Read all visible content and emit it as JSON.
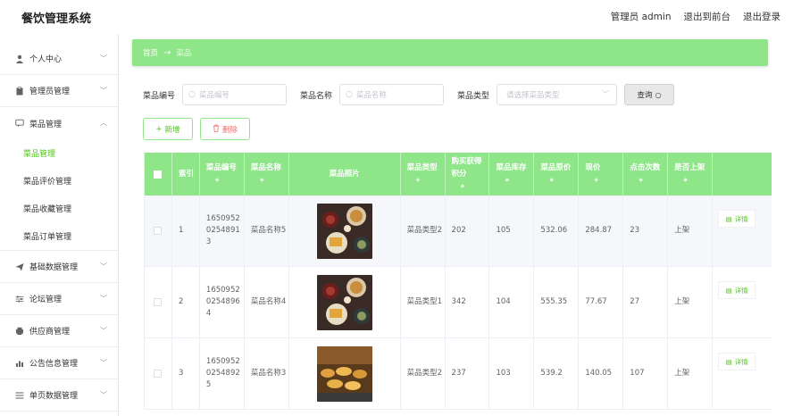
{
  "header": {
    "app_title": "餐饮管理系统",
    "admin_label": "管理员 admin",
    "back_frontend": "退出到前台",
    "logout": "退出登录"
  },
  "sidebar": {
    "groups": [
      {
        "label": "个人中心",
        "icon": "user-icon"
      },
      {
        "label": "管理员管理",
        "icon": "clipboard-icon"
      },
      {
        "label": "菜品管理",
        "icon": "chat-icon",
        "expanded": true,
        "children": [
          "菜品管理",
          "菜品评价管理",
          "菜品收藏管理",
          "菜品订单管理"
        ]
      },
      {
        "label": "基础数据管理",
        "icon": "send-icon"
      },
      {
        "label": "论坛管理",
        "icon": "sliders-icon"
      },
      {
        "label": "供应商管理",
        "icon": "printer-icon"
      },
      {
        "label": "公告信息管理",
        "icon": "chart-icon"
      },
      {
        "label": "单页数据管理",
        "icon": "menu-icon"
      }
    ],
    "active_child": "菜品管理"
  },
  "breadcrumb": {
    "home": "首页",
    "current": "菜品"
  },
  "filters": {
    "code_label": "菜品编号",
    "code_placeholder": "菜品编号",
    "name_label": "菜品名称",
    "name_placeholder": "菜品名称",
    "type_label": "菜品类型",
    "type_placeholder": "请选择菜品类型",
    "query_button": "查询"
  },
  "actions": {
    "add": "新增",
    "delete": "删除"
  },
  "table": {
    "headers": [
      "索引",
      "菜品编号",
      "菜品名称",
      "菜品照片",
      "菜品类型",
      "购买获得积分",
      "菜品库存",
      "菜品原价",
      "现价",
      "点击次数",
      "是否上架"
    ],
    "detail_label": "详情",
    "rows": [
      {
        "index": "1",
        "code": "16509520254891 3",
        "name": "菜品名称5",
        "type": "菜品类型2",
        "points": "202",
        "stock": "105",
        "orig_price": "532.06",
        "price": "284.87",
        "clicks": "23",
        "onsale": "上架"
      },
      {
        "index": "2",
        "code": "16509520254896 4",
        "name": "菜品名称4",
        "type": "菜品类型1",
        "points": "342",
        "stock": "104",
        "orig_price": "555.35",
        "price": "77.67",
        "clicks": "27",
        "onsale": "上架"
      },
      {
        "index": "3",
        "code": "16509520254892 5",
        "name": "菜品名称3",
        "type": "菜品类型2",
        "points": "237",
        "stock": "103",
        "orig_price": "539.2",
        "price": "140.05",
        "clicks": "107",
        "onsale": "上架"
      }
    ]
  },
  "colors": {
    "accent": "#8fe689",
    "active_text": "#52c41a",
    "danger": "#f56c6c"
  }
}
